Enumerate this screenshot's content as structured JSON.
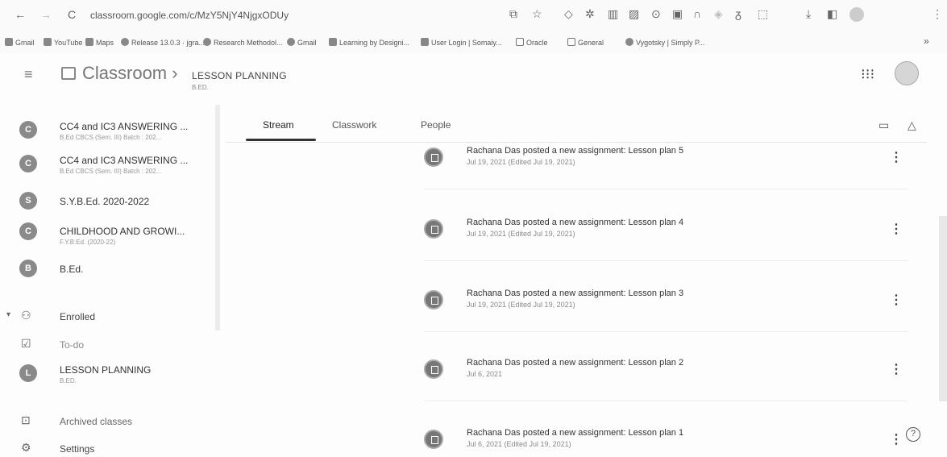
{
  "browser": {
    "address": "classroom.google.com/c/MzY5NjY4NjgxODUy",
    "bookmarks": [
      {
        "label": "Gmail"
      },
      {
        "label": "YouTube"
      },
      {
        "label": "Maps"
      },
      {
        "label": "Release 13.0.3 · jgra..."
      },
      {
        "label": "Research Methodol..."
      },
      {
        "label": "Gmail"
      },
      {
        "label": "Learning by Designi..."
      },
      {
        "label": "User Login | Somaiy..."
      },
      {
        "label": "Oracle"
      },
      {
        "label": "General"
      },
      {
        "label": "Vygotsky | Simply P..."
      }
    ]
  },
  "header": {
    "app_title": "Classroom",
    "separator": "›",
    "course_name": "LESSON PLANNING",
    "course_sub": "B.ED."
  },
  "sidebar": {
    "classes": [
      {
        "initial": "C",
        "name": "CC4 and IC3 ANSWERING ...",
        "sub": "B.Ed CBCS (Sem. III) Batch : 202..."
      },
      {
        "initial": "C",
        "name": "CC4 and IC3 ANSWERING ...",
        "sub": "B.Ed CBCS (Sem. III) Batch : 202..."
      },
      {
        "initial": "S",
        "name": "S.Y.B.Ed. 2020-2022",
        "sub": ""
      },
      {
        "initial": "C",
        "name": "CHILDHOOD AND GROWI...",
        "sub": "F.Y.B.Ed. (2020-22)"
      },
      {
        "initial": "B",
        "name": "B.Ed.",
        "sub": ""
      }
    ],
    "enrolled_label": "Enrolled",
    "todo_label": "To-do",
    "enrolled_class": {
      "initial": "L",
      "name": "LESSON PLANNING",
      "sub": "B.ED."
    },
    "archived_label": "Archived classes",
    "settings_label": "Settings"
  },
  "tabs": [
    {
      "label": "Stream"
    },
    {
      "label": "Classwork"
    },
    {
      "label": "People"
    }
  ],
  "stream": {
    "posts": [
      {
        "title": "Rachana Das posted a new assignment: Lesson plan 5",
        "date": "Jul 19, 2021 (Edited Jul 19, 2021)"
      },
      {
        "title": "Rachana Das posted a new assignment: Lesson plan 4",
        "date": "Jul 19, 2021 (Edited Jul 19, 2021)"
      },
      {
        "title": "Rachana Das posted a new assignment: Lesson plan 3",
        "date": "Jul 19, 2021 (Edited Jul 19, 2021)"
      },
      {
        "title": "Rachana Das posted a new assignment: Lesson plan 2",
        "date": "Jul 6, 2021"
      },
      {
        "title": "Rachana Das posted a new assignment: Lesson plan 1",
        "date": "Jul 6, 2021 (Edited Jul 19, 2021)"
      }
    ]
  },
  "icons": {
    "back": "arrow-left-icon",
    "forward": "arrow-right-icon",
    "reload": "reload-icon",
    "apps": "apps-grid-icon",
    "calendar": "calendar-icon",
    "drive": "drive-icon",
    "help": "help-icon"
  }
}
